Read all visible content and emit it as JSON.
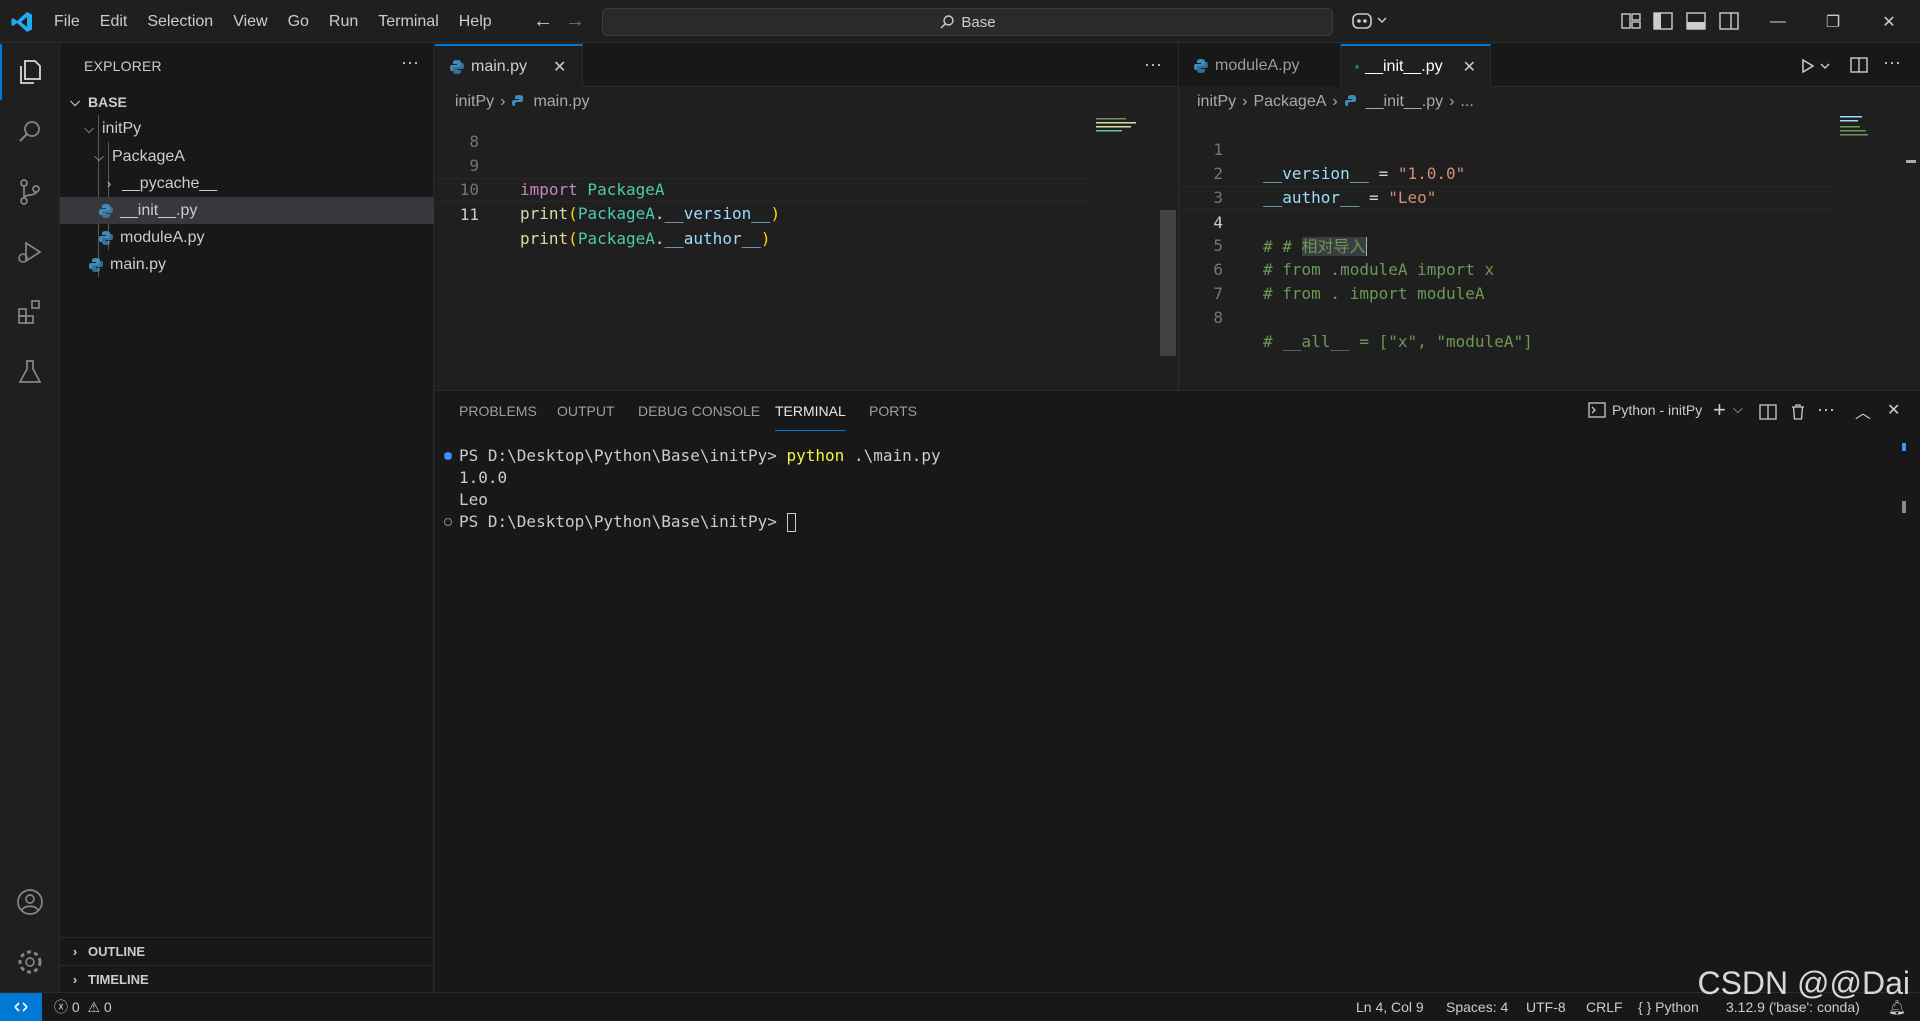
{
  "menu": [
    "File",
    "Edit",
    "Selection",
    "View",
    "Go",
    "Run",
    "Terminal",
    "Help"
  ],
  "command_center": {
    "text": "Base"
  },
  "sidebar": {
    "title": "EXPLORER",
    "root": "BASE",
    "tree": [
      {
        "label": "initPy",
        "kind": "folder-open"
      },
      {
        "label": "PackageA",
        "kind": "folder-open"
      },
      {
        "label": "__pycache__",
        "kind": "folder-closed"
      },
      {
        "label": "__init__.py",
        "kind": "python-file"
      },
      {
        "label": "moduleA.py",
        "kind": "python-file"
      },
      {
        "label": "main.py",
        "kind": "python-file"
      }
    ],
    "outline": "OUTLINE",
    "timeline": "TIMELINE"
  },
  "left_editor": {
    "tab": "main.py",
    "breadcrumb": [
      "initPy",
      "main.py"
    ],
    "lines": [
      {
        "n": "8"
      },
      {
        "n": "9",
        "t1": "import",
        "t2": " PackageA"
      },
      {
        "n": "10",
        "t1": "print",
        "t2": "(",
        "t3": "PackageA",
        "t4": ".",
        "t5": "__version__",
        "t6": ")"
      },
      {
        "n": "11",
        "t1": "print",
        "t2": "(",
        "t3": "PackageA",
        "t4": ".",
        "t5": "__author__",
        "t6": ")"
      }
    ]
  },
  "right_editor": {
    "tabs": [
      "moduleA.py",
      "__init__.py"
    ],
    "breadcrumb": [
      "initPy",
      "PackageA",
      "__init__.py",
      "..."
    ],
    "lines": [
      {
        "n": "1",
        "a": "__version__",
        "b": " = ",
        "c": "\"1.0.0\""
      },
      {
        "n": "2",
        "a": "__author__",
        "b": " = ",
        "c": "\"Leo\""
      },
      {
        "n": "3"
      },
      {
        "n": "4",
        "a": "# # ",
        "c": "相对导入"
      },
      {
        "n": "5",
        "a": "# from .moduleA import x"
      },
      {
        "n": "6",
        "a": "# from . import moduleA"
      },
      {
        "n": "7"
      },
      {
        "n": "8",
        "a": "# __all__ = [\"x\", \"moduleA\"]"
      }
    ]
  },
  "panel": {
    "tabs": [
      "PROBLEMS",
      "OUTPUT",
      "DEBUG CONSOLE",
      "TERMINAL",
      "PORTS"
    ],
    "active_tab": "TERMINAL",
    "terminal_name": "Python - initPy",
    "lines": [
      {
        "prompt": "PS D:\\Desktop\\Python\\Base\\initPy> ",
        "cmd": "python",
        "args": " .\\main.py"
      },
      {
        "out": "1.0.0"
      },
      {
        "out": "Leo"
      },
      {
        "prompt": "PS D:\\Desktop\\Python\\Base\\initPy> "
      }
    ]
  },
  "status": {
    "errors": "0",
    "warnings": "0",
    "position": "Ln 4, Col 9",
    "spaces": "Spaces: 4",
    "encoding": "UTF-8",
    "eol": "CRLF",
    "language": "Python",
    "interpreter": "3.12.9 ('base': conda)"
  },
  "watermark": "CSDN @@Dai",
  "colors": {
    "accent": "#0078d4",
    "python_icon": "#3c8dbc"
  }
}
